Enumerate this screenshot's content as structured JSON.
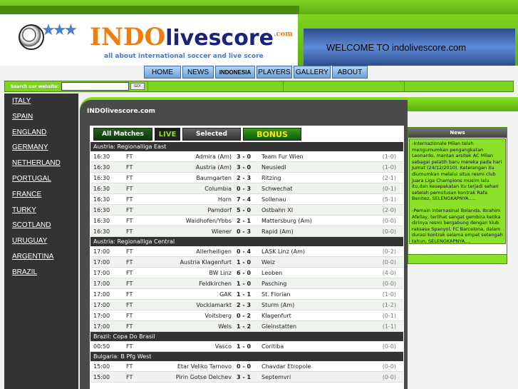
{
  "header": {
    "logo_main": "INDO",
    "logo_rest": "livescore",
    "logo_tld": ".com",
    "logo_tagline": "all about international soccer and live score",
    "welcome": "WELCOME TO indolivescore.com"
  },
  "nav": [
    "HOME",
    "NEWS",
    "INDONESIA",
    "PLAYERS",
    "GALLERY",
    "ABOUT"
  ],
  "search": {
    "label": "Search our website:",
    "button": "GO!"
  },
  "sidebar": [
    "ITALY",
    "SPAIN",
    "ENGLAND",
    "GERMANY",
    "NETHERLAND",
    "PORTUGAL",
    "FRANCE",
    "TURKY",
    "SCOTLAND",
    "URUGUAY",
    "ARGENTINA",
    "BRAZIL"
  ],
  "main": {
    "title": "INDOlivescore.com"
  },
  "tabs": {
    "all": "All Matches",
    "live": "LIVE",
    "selected": "Selected",
    "bonus": "BONUS"
  },
  "leagues": [
    {
      "name": "Austria: Regionalliga East",
      "matches": [
        {
          "time": "16:30",
          "status": "FT",
          "home": "Admira (Am)",
          "score": "3 - 0",
          "away": "Team Fur Wien",
          "ht": "(1-0)"
        },
        {
          "time": "16:30",
          "status": "FT",
          "home": "Austria (Am)",
          "score": "3 - 0",
          "away": "Neusiedl",
          "ht": "(1-0)"
        },
        {
          "time": "16:30",
          "status": "FT",
          "home": "Baumgarten",
          "score": "2 - 3",
          "away": "Ritzing",
          "ht": "(2-1)"
        },
        {
          "time": "16:30",
          "status": "FT",
          "home": "Columbia",
          "score": "0 - 3",
          "away": "Schwechat",
          "ht": "(0-1)"
        },
        {
          "time": "16:30",
          "status": "FT",
          "home": "Horn",
          "score": "7 - 4",
          "away": "Sollenau",
          "ht": "(5-1)"
        },
        {
          "time": "16:30",
          "status": "FT",
          "home": "Parndorf",
          "score": "5 - 0",
          "away": "Ostbahn XI",
          "ht": "(2-0)"
        },
        {
          "time": "16:30",
          "status": "FT",
          "home": "Waidhofen/Ybbs",
          "score": "2 - 1",
          "away": "Mattersburg (Am)",
          "ht": "(0-0)"
        },
        {
          "time": "16:30",
          "status": "FT",
          "home": "Wiener",
          "score": "0 - 3",
          "away": "Rapid (Am)",
          "ht": "(0-0)"
        }
      ]
    },
    {
      "name": "Austria: Regionalliga Central",
      "matches": [
        {
          "time": "17:00",
          "status": "FT",
          "home": "Allerheiligen",
          "score": "0 - 4",
          "away": "LASK Linz (Am)",
          "ht": "(0-2)"
        },
        {
          "time": "17:00",
          "status": "FT",
          "home": "Austria Klagenfurt",
          "score": "1 - 0",
          "away": "Weiz",
          "ht": "(0-0)"
        },
        {
          "time": "17:00",
          "status": "FT",
          "home": "BW Linz",
          "score": "6 - 0",
          "away": "Leoben",
          "ht": "(4-0)"
        },
        {
          "time": "17:00",
          "status": "FT",
          "home": "Feldkirchen",
          "score": "1 - 0",
          "away": "Pasching",
          "ht": "(0-0)"
        },
        {
          "time": "17:00",
          "status": "FT",
          "home": "GAK",
          "score": "1 - 1",
          "away": "St. Florian",
          "ht": "(1-0)"
        },
        {
          "time": "17:00",
          "status": "FT",
          "home": "Vocklamarkt",
          "score": "2 - 3",
          "away": "Sturm (Am)",
          "ht": "(1-2)"
        },
        {
          "time": "17:00",
          "status": "FT",
          "home": "Voitsberg",
          "score": "0 - 2",
          "away": "Klagenfurt",
          "ht": "(0-1)"
        },
        {
          "time": "17:00",
          "status": "FT",
          "home": "Wels",
          "score": "1 - 2",
          "away": "Gleinstatten",
          "ht": "(1-1)"
        }
      ]
    },
    {
      "name": "Brazil: Copa Do Brasil",
      "matches": [
        {
          "time": "00:50",
          "status": "FT",
          "home": "Vasco",
          "score": "1 - 0",
          "away": "Coritiba",
          "ht": "(0-0)"
        }
      ]
    },
    {
      "name": "Bulgaria: B Pfg West",
      "matches": [
        {
          "time": "15:00",
          "status": "FT",
          "home": "Etar Veliko Tarnovo",
          "score": "0 - 0",
          "away": "Chavdar Etropole",
          "ht": "(0-0)"
        },
        {
          "time": "15:00",
          "status": "FT",
          "home": "Pirin Gotse Delchev",
          "score": "3 - 1",
          "away": "Septemvri",
          "ht": "(0-0)"
        }
      ]
    }
  ],
  "news": {
    "title": "News",
    "items": [
      "-Internazionale Milan telah mengumumkan pengangkatan Leonardo, mantan arsitek AC Milan sebagai pelatih baru mereka pada hari Jumat (24/12/2010). Keterangan itu diumumkan melalui situs resmi club juara Liga Champions musim lalu itu,dan kesepakatan itu terjadi sehari setelah pemutusan kontrak Rafa Benitez, SELENGKAPNYA.....",
      "-Pemain internasinal Belanda, Ibrahim Afellay, terlihat sangat gembira ketika dirinya resmi bergabung dengan klub raksasa Spanyol, FC Barcelona, dalam durasi kontrak selama empat setengah tahun, SELENGKAPNYA...."
    ]
  }
}
